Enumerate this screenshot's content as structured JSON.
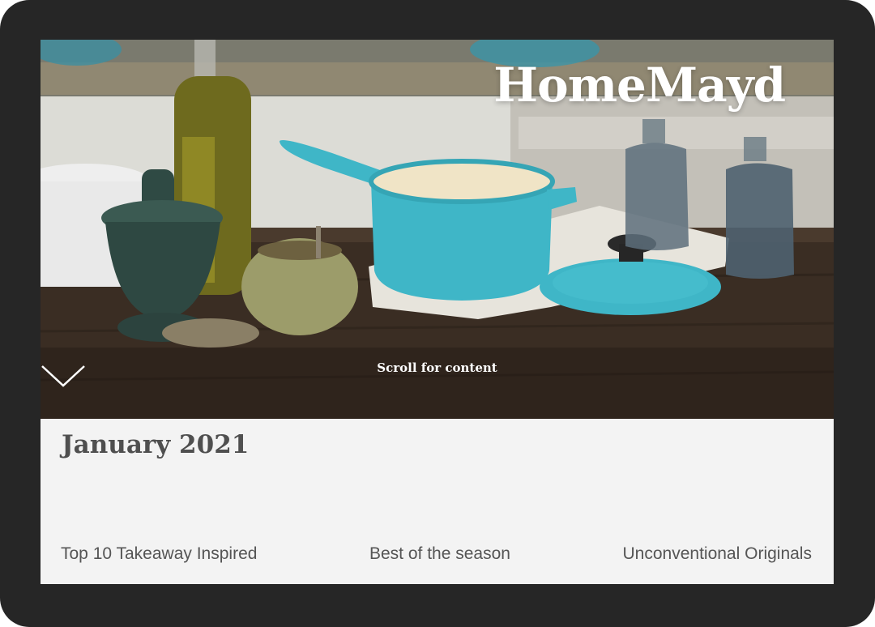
{
  "brand": {
    "name": "HomeMayd"
  },
  "hero": {
    "scroll_label": "Scroll for content"
  },
  "content": {
    "month_title": "January 2021",
    "categories": [
      {
        "label": "Top 10 Takeaway Inspired"
      },
      {
        "label": "Best of the season"
      },
      {
        "label": "Unconventional Originals"
      }
    ]
  },
  "colors": {
    "frame": "#262626",
    "panel": "#f3f3f3",
    "text": "#555555",
    "accent_teal": "#3fb6c7"
  }
}
